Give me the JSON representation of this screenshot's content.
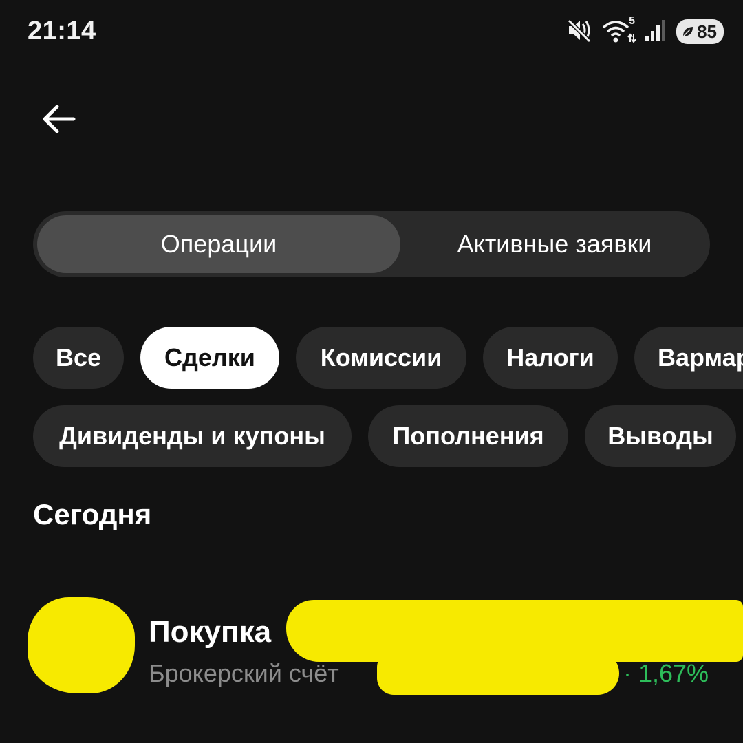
{
  "status_bar": {
    "time": "21:14",
    "battery": "85",
    "wifi_badge": "5",
    "icons": [
      "mute-icon",
      "wifi-icon",
      "signal-icon",
      "battery-icon"
    ]
  },
  "header": {
    "back_icon": "arrow-left-icon"
  },
  "tabs": {
    "active": "Операции",
    "inactive": "Активные заявки"
  },
  "filters": {
    "row1": [
      "Все",
      "Сделки",
      "Комиссии",
      "Налоги",
      "Вармаржа"
    ],
    "row2": [
      "Дивиденды и купоны",
      "Пополнения",
      "Выводы"
    ],
    "selected": "Сделки"
  },
  "section": {
    "title": "Сегодня"
  },
  "operation": {
    "title": "Покупка",
    "subtitle": "Брокерский счёт",
    "change": "· 1,67%",
    "change_color": "#2dbd5a",
    "redaction_color": "#f7ea00"
  }
}
